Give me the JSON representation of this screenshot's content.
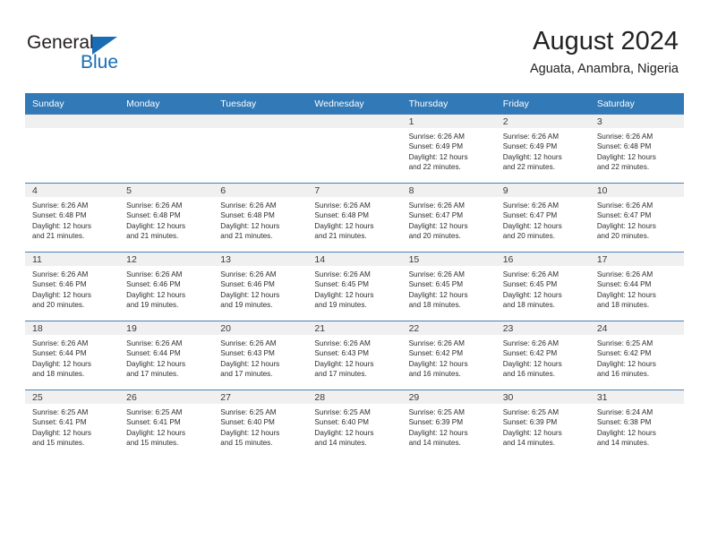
{
  "brand": {
    "name_dark": "General",
    "name_blue": "Blue",
    "accent_color": "#1a6cb5"
  },
  "header": {
    "title": "August 2024",
    "location": "Aguata, Anambra, Nigeria"
  },
  "calendar": {
    "header_bg": "#3279b7",
    "daynum_band_bg": "#f0f0f0",
    "weekday_headers": [
      "Sunday",
      "Monday",
      "Tuesday",
      "Wednesday",
      "Thursday",
      "Friday",
      "Saturday"
    ],
    "weeks": [
      [
        {
          "day": "",
          "empty": true
        },
        {
          "day": "",
          "empty": true
        },
        {
          "day": "",
          "empty": true
        },
        {
          "day": "",
          "empty": true
        },
        {
          "day": "1",
          "sunrise": "Sunrise: 6:26 AM",
          "sunset": "Sunset: 6:49 PM",
          "daylight_1": "Daylight: 12 hours",
          "daylight_2": "and 22 minutes."
        },
        {
          "day": "2",
          "sunrise": "Sunrise: 6:26 AM",
          "sunset": "Sunset: 6:49 PM",
          "daylight_1": "Daylight: 12 hours",
          "daylight_2": "and 22 minutes."
        },
        {
          "day": "3",
          "sunrise": "Sunrise: 6:26 AM",
          "sunset": "Sunset: 6:48 PM",
          "daylight_1": "Daylight: 12 hours",
          "daylight_2": "and 22 minutes."
        }
      ],
      [
        {
          "day": "4",
          "sunrise": "Sunrise: 6:26 AM",
          "sunset": "Sunset: 6:48 PM",
          "daylight_1": "Daylight: 12 hours",
          "daylight_2": "and 21 minutes."
        },
        {
          "day": "5",
          "sunrise": "Sunrise: 6:26 AM",
          "sunset": "Sunset: 6:48 PM",
          "daylight_1": "Daylight: 12 hours",
          "daylight_2": "and 21 minutes."
        },
        {
          "day": "6",
          "sunrise": "Sunrise: 6:26 AM",
          "sunset": "Sunset: 6:48 PM",
          "daylight_1": "Daylight: 12 hours",
          "daylight_2": "and 21 minutes."
        },
        {
          "day": "7",
          "sunrise": "Sunrise: 6:26 AM",
          "sunset": "Sunset: 6:48 PM",
          "daylight_1": "Daylight: 12 hours",
          "daylight_2": "and 21 minutes."
        },
        {
          "day": "8",
          "sunrise": "Sunrise: 6:26 AM",
          "sunset": "Sunset: 6:47 PM",
          "daylight_1": "Daylight: 12 hours",
          "daylight_2": "and 20 minutes."
        },
        {
          "day": "9",
          "sunrise": "Sunrise: 6:26 AM",
          "sunset": "Sunset: 6:47 PM",
          "daylight_1": "Daylight: 12 hours",
          "daylight_2": "and 20 minutes."
        },
        {
          "day": "10",
          "sunrise": "Sunrise: 6:26 AM",
          "sunset": "Sunset: 6:47 PM",
          "daylight_1": "Daylight: 12 hours",
          "daylight_2": "and 20 minutes."
        }
      ],
      [
        {
          "day": "11",
          "sunrise": "Sunrise: 6:26 AM",
          "sunset": "Sunset: 6:46 PM",
          "daylight_1": "Daylight: 12 hours",
          "daylight_2": "and 20 minutes."
        },
        {
          "day": "12",
          "sunrise": "Sunrise: 6:26 AM",
          "sunset": "Sunset: 6:46 PM",
          "daylight_1": "Daylight: 12 hours",
          "daylight_2": "and 19 minutes."
        },
        {
          "day": "13",
          "sunrise": "Sunrise: 6:26 AM",
          "sunset": "Sunset: 6:46 PM",
          "daylight_1": "Daylight: 12 hours",
          "daylight_2": "and 19 minutes."
        },
        {
          "day": "14",
          "sunrise": "Sunrise: 6:26 AM",
          "sunset": "Sunset: 6:45 PM",
          "daylight_1": "Daylight: 12 hours",
          "daylight_2": "and 19 minutes."
        },
        {
          "day": "15",
          "sunrise": "Sunrise: 6:26 AM",
          "sunset": "Sunset: 6:45 PM",
          "daylight_1": "Daylight: 12 hours",
          "daylight_2": "and 18 minutes."
        },
        {
          "day": "16",
          "sunrise": "Sunrise: 6:26 AM",
          "sunset": "Sunset: 6:45 PM",
          "daylight_1": "Daylight: 12 hours",
          "daylight_2": "and 18 minutes."
        },
        {
          "day": "17",
          "sunrise": "Sunrise: 6:26 AM",
          "sunset": "Sunset: 6:44 PM",
          "daylight_1": "Daylight: 12 hours",
          "daylight_2": "and 18 minutes."
        }
      ],
      [
        {
          "day": "18",
          "sunrise": "Sunrise: 6:26 AM",
          "sunset": "Sunset: 6:44 PM",
          "daylight_1": "Daylight: 12 hours",
          "daylight_2": "and 18 minutes."
        },
        {
          "day": "19",
          "sunrise": "Sunrise: 6:26 AM",
          "sunset": "Sunset: 6:44 PM",
          "daylight_1": "Daylight: 12 hours",
          "daylight_2": "and 17 minutes."
        },
        {
          "day": "20",
          "sunrise": "Sunrise: 6:26 AM",
          "sunset": "Sunset: 6:43 PM",
          "daylight_1": "Daylight: 12 hours",
          "daylight_2": "and 17 minutes."
        },
        {
          "day": "21",
          "sunrise": "Sunrise: 6:26 AM",
          "sunset": "Sunset: 6:43 PM",
          "daylight_1": "Daylight: 12 hours",
          "daylight_2": "and 17 minutes."
        },
        {
          "day": "22",
          "sunrise": "Sunrise: 6:26 AM",
          "sunset": "Sunset: 6:42 PM",
          "daylight_1": "Daylight: 12 hours",
          "daylight_2": "and 16 minutes."
        },
        {
          "day": "23",
          "sunrise": "Sunrise: 6:26 AM",
          "sunset": "Sunset: 6:42 PM",
          "daylight_1": "Daylight: 12 hours",
          "daylight_2": "and 16 minutes."
        },
        {
          "day": "24",
          "sunrise": "Sunrise: 6:25 AM",
          "sunset": "Sunset: 6:42 PM",
          "daylight_1": "Daylight: 12 hours",
          "daylight_2": "and 16 minutes."
        }
      ],
      [
        {
          "day": "25",
          "sunrise": "Sunrise: 6:25 AM",
          "sunset": "Sunset: 6:41 PM",
          "daylight_1": "Daylight: 12 hours",
          "daylight_2": "and 15 minutes."
        },
        {
          "day": "26",
          "sunrise": "Sunrise: 6:25 AM",
          "sunset": "Sunset: 6:41 PM",
          "daylight_1": "Daylight: 12 hours",
          "daylight_2": "and 15 minutes."
        },
        {
          "day": "27",
          "sunrise": "Sunrise: 6:25 AM",
          "sunset": "Sunset: 6:40 PM",
          "daylight_1": "Daylight: 12 hours",
          "daylight_2": "and 15 minutes."
        },
        {
          "day": "28",
          "sunrise": "Sunrise: 6:25 AM",
          "sunset": "Sunset: 6:40 PM",
          "daylight_1": "Daylight: 12 hours",
          "daylight_2": "and 14 minutes."
        },
        {
          "day": "29",
          "sunrise": "Sunrise: 6:25 AM",
          "sunset": "Sunset: 6:39 PM",
          "daylight_1": "Daylight: 12 hours",
          "daylight_2": "and 14 minutes."
        },
        {
          "day": "30",
          "sunrise": "Sunrise: 6:25 AM",
          "sunset": "Sunset: 6:39 PM",
          "daylight_1": "Daylight: 12 hours",
          "daylight_2": "and 14 minutes."
        },
        {
          "day": "31",
          "sunrise": "Sunrise: 6:24 AM",
          "sunset": "Sunset: 6:38 PM",
          "daylight_1": "Daylight: 12 hours",
          "daylight_2": "and 14 minutes."
        }
      ]
    ]
  }
}
